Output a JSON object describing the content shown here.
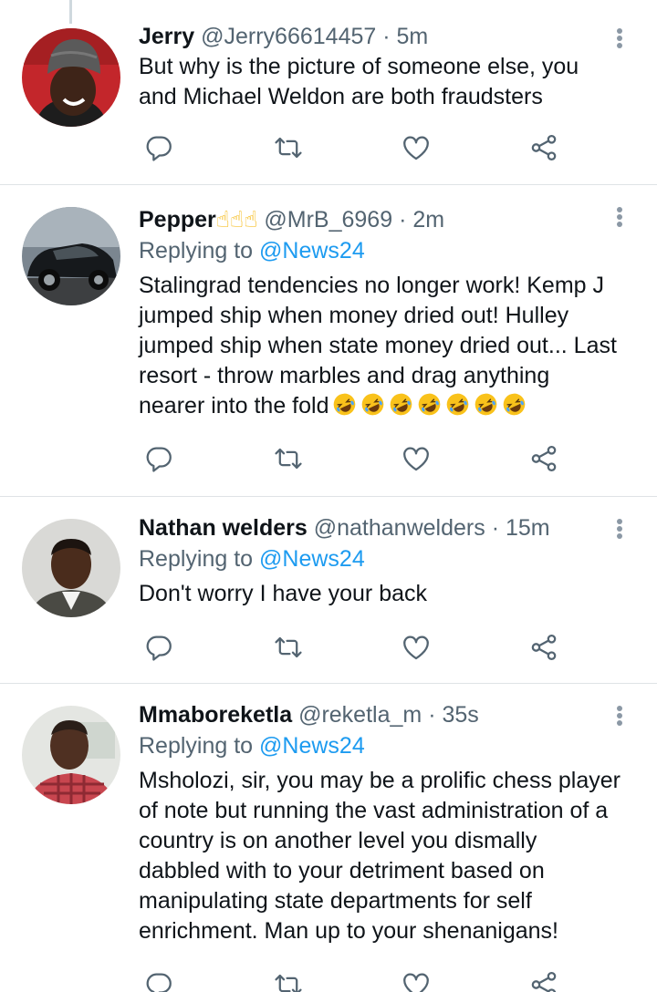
{
  "tweets": [
    {
      "name": "Jerry",
      "handle": "@Jerry66614457",
      "time": "· 5m",
      "replying_prefix": "",
      "replying_mention": "",
      "text": "But why is the picture of someone else, you and Michael Weldon are both fraudsters",
      "avatar_icon": "man-with-beanie-avatar"
    },
    {
      "name": "Pepper",
      "name_emoji": "☝☝☝",
      "handle": "@MrB_6969",
      "time": "· 2m",
      "replying_prefix": "Replying to ",
      "replying_mention": "@News24",
      "text": "Stalingrad tendencies no longer work! Kemp J jumped ship when money dried out! Hulley jumped ship when state money dried out... Last resort - throw marbles and drag anything nearer into the fold",
      "text_emoji_count": 7,
      "avatar_icon": "black-car-avatar"
    },
    {
      "name": "Nathan welders",
      "handle": "@nathanwelders",
      "time": "· 15m",
      "replying_prefix": "Replying to ",
      "replying_mention": "@News24",
      "text": "Don't worry I have your back",
      "avatar_icon": "man-portrait-avatar"
    },
    {
      "name": "Mmaboreketla",
      "handle": "@reketla_m",
      "time": "· 35s",
      "replying_prefix": "Replying to ",
      "replying_mention": "@News24",
      "text": "Msholozi, sir, you may be a prolific chess player of note but running the vast administration of a country is on another level you dismally dabbled with to your detriment based on manipulating state departments for self enrichment. Man up to your shenanigans!",
      "avatar_icon": "man-plaid-shirt-avatar"
    }
  ],
  "colors": {
    "text": "#0f1419",
    "secondary": "#536471",
    "link": "#1d9bf0",
    "icon": "#536471",
    "divider": "#dfe3e6"
  },
  "action_icons": [
    "reply-icon",
    "retweet-icon",
    "like-icon",
    "share-icon"
  ]
}
